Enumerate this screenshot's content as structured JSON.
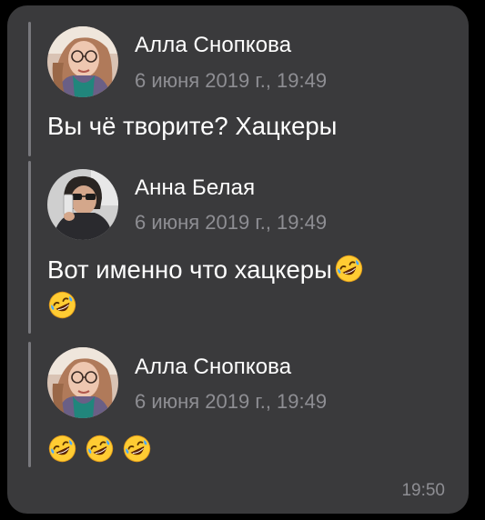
{
  "messages": [
    {
      "sender": "Алла Снопкова",
      "date": "6 июня 2019 г., 19:49",
      "text": "Вы чё творите? Хацкеры",
      "emoji_count": 0,
      "avatar": "woman-with-glasses-photo"
    },
    {
      "sender": "Анна Белая",
      "date": "6 июня 2019 г., 19:49",
      "text": "Вот именно что хацкеры",
      "emoji_count": 2,
      "emoji": "rolling-on-the-floor-laughing",
      "avatar": "woman-with-sunglasses-phone-photo"
    },
    {
      "sender": "Алла Снопкова",
      "date": "6 июня 2019 г., 19:49",
      "text": "",
      "emoji_count": 3,
      "emoji": "rolling-on-the-floor-laughing",
      "avatar": "woman-with-glasses-photo"
    }
  ],
  "time": "19:50",
  "colors": {
    "background": "#000000",
    "bubble": "#3a3a3c",
    "text": "#ffffff",
    "secondary": "#8e8e93",
    "forward_bar": "#78787d"
  }
}
